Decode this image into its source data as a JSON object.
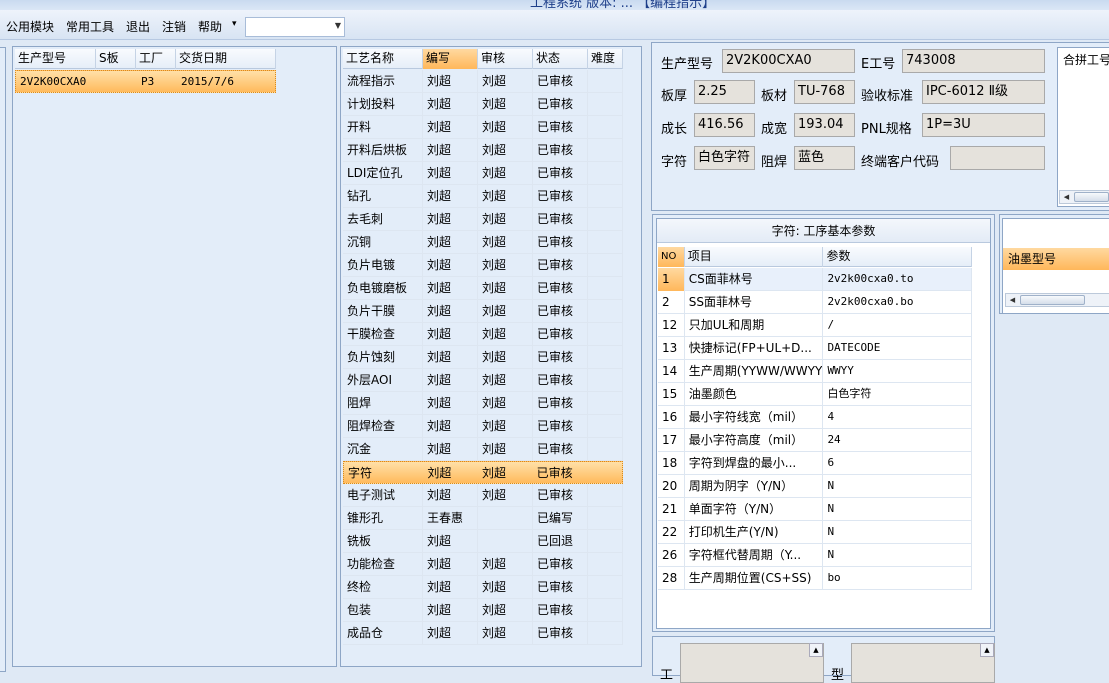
{
  "window": {
    "title": "工程系统 版本: ... 【编程指示】"
  },
  "menu": {
    "items": [
      "公用模块",
      "常用工具",
      "退出",
      "注销",
      "帮助"
    ],
    "help_arrow": "▾",
    "combo_value": ""
  },
  "orders": {
    "headers": [
      "生产型号",
      "S板",
      "工厂",
      "交货日期"
    ],
    "rows": [
      {
        "model": "2V2K00CXA0",
        "sboard": "",
        "factory": "P3",
        "date": "2015/7/6"
      }
    ]
  },
  "processes": {
    "headers": [
      "工艺名称",
      "编写",
      "审核",
      "状态",
      "难度"
    ],
    "rows": [
      {
        "name": "流程指示",
        "writer": "刘超",
        "reviewer": "刘超",
        "status": "已审核"
      },
      {
        "name": "计划投料",
        "writer": "刘超",
        "reviewer": "刘超",
        "status": "已审核"
      },
      {
        "name": "开料",
        "writer": "刘超",
        "reviewer": "刘超",
        "status": "已审核"
      },
      {
        "name": "开料后烘板",
        "writer": "刘超",
        "reviewer": "刘超",
        "status": "已审核"
      },
      {
        "name": "LDI定位孔",
        "writer": "刘超",
        "reviewer": "刘超",
        "status": "已审核"
      },
      {
        "name": "钻孔",
        "writer": "刘超",
        "reviewer": "刘超",
        "status": "已审核"
      },
      {
        "name": "去毛刺",
        "writer": "刘超",
        "reviewer": "刘超",
        "status": "已审核"
      },
      {
        "name": "沉铜",
        "writer": "刘超",
        "reviewer": "刘超",
        "status": "已审核"
      },
      {
        "name": "负片电镀",
        "writer": "刘超",
        "reviewer": "刘超",
        "status": "已审核"
      },
      {
        "name": "负电镀磨板",
        "writer": "刘超",
        "reviewer": "刘超",
        "status": "已审核"
      },
      {
        "name": "负片干膜",
        "writer": "刘超",
        "reviewer": "刘超",
        "status": "已审核"
      },
      {
        "name": "干膜检查",
        "writer": "刘超",
        "reviewer": "刘超",
        "status": "已审核"
      },
      {
        "name": "负片蚀刻",
        "writer": "刘超",
        "reviewer": "刘超",
        "status": "已审核"
      },
      {
        "name": "外层AOI",
        "writer": "刘超",
        "reviewer": "刘超",
        "status": "已审核"
      },
      {
        "name": "阻焊",
        "writer": "刘超",
        "reviewer": "刘超",
        "status": "已审核"
      },
      {
        "name": "阻焊检查",
        "writer": "刘超",
        "reviewer": "刘超",
        "status": "已审核"
      },
      {
        "name": "沉金",
        "writer": "刘超",
        "reviewer": "刘超",
        "status": "已审核"
      },
      {
        "name": "字符",
        "writer": "刘超",
        "reviewer": "刘超",
        "status": "已审核"
      },
      {
        "name": "电子测试",
        "writer": "刘超",
        "reviewer": "刘超",
        "status": "已审核"
      },
      {
        "name": "锥形孔",
        "writer": "王春惠",
        "reviewer": "",
        "status": "已编写"
      },
      {
        "name": "铣板",
        "writer": "刘超",
        "reviewer": "",
        "status": "已回退"
      },
      {
        "name": "功能检查",
        "writer": "刘超",
        "reviewer": "刘超",
        "status": "已审核"
      },
      {
        "name": "终检",
        "writer": "刘超",
        "reviewer": "刘超",
        "status": "已审核"
      },
      {
        "name": "包装",
        "writer": "刘超",
        "reviewer": "刘超",
        "status": "已审核"
      },
      {
        "name": "成品仓",
        "writer": "刘超",
        "reviewer": "刘超",
        "status": "已审核"
      }
    ],
    "selected_index": 17
  },
  "info": {
    "model_label": "生产型号",
    "model_value": "2V2K00CXA0",
    "eno_label": "E工号",
    "eno_value": "743008",
    "thickness_label": "板厚",
    "thickness_value": "2.25",
    "material_label": "板材",
    "material_value": "TU-768",
    "standard_label": "验收标准",
    "standard_value": "IPC-6012 Ⅱ级",
    "length_label": "成长",
    "length_value": "416.56",
    "width_label": "成宽",
    "width_value": "193.04",
    "pnl_label": "PNL规格",
    "pnl_value": "1P=3U",
    "char_label": "字符",
    "char_value": "白色字符",
    "mask_label": "阻焊",
    "mask_value": "蓝色",
    "customer_label": "终端客户代码",
    "customer_value": "",
    "merge_label": "合拼工号"
  },
  "params": {
    "title": "字符: 工序基本参数",
    "headers": [
      "NO",
      "项目",
      "参数"
    ],
    "rows": [
      {
        "no": "1",
        "item": "CS面菲林号",
        "value": "2v2k00cxa0.to"
      },
      {
        "no": "2",
        "item": "SS面菲林号",
        "value": "2v2k00cxa0.bo"
      },
      {
        "no": "12",
        "item": "只加UL和周期",
        "value": "/"
      },
      {
        "no": "13",
        "item": "快捷标记(FP+UL+D...",
        "value": "DATECODE"
      },
      {
        "no": "14",
        "item": "生产周期(YYWW/WWYY)",
        "value": "WWYY"
      },
      {
        "no": "15",
        "item": "油墨颜色",
        "value": "白色字符"
      },
      {
        "no": "16",
        "item": "最小字符线宽（mil）",
        "value": "4"
      },
      {
        "no": "17",
        "item": "最小字符高度（mil）",
        "value": "24"
      },
      {
        "no": "18",
        "item": "字符到焊盘的最小...",
        "value": "6"
      },
      {
        "no": "20",
        "item": "周期为阴字（Y/N）",
        "value": "N"
      },
      {
        "no": "21",
        "item": "单面字符（Y/N）",
        "value": "N"
      },
      {
        "no": "22",
        "item": "打印机生产(Y/N)",
        "value": "N"
      },
      {
        "no": "26",
        "item": "字符框代替周期（Y...",
        "value": "N"
      },
      {
        "no": "28",
        "item": "生产周期位置(CS+SS)",
        "value": "bo"
      }
    ]
  },
  "ink": {
    "header": "油墨型号"
  },
  "bottom": {
    "label1": "工",
    "label2": "型"
  }
}
